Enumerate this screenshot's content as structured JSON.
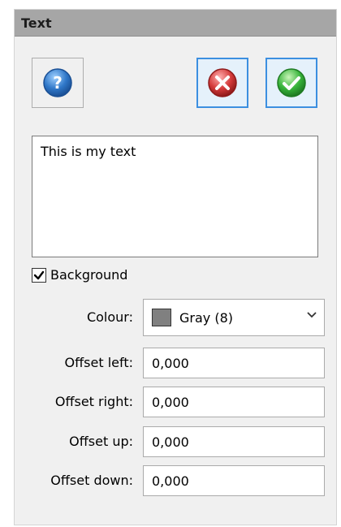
{
  "window": {
    "title": "Text"
  },
  "text_editor": {
    "value": "This is my text"
  },
  "background_checkbox": {
    "label": "Background",
    "checked": true
  },
  "colour": {
    "label": "Colour:",
    "value": "Gray (8)",
    "swatch_color": "#808080"
  },
  "offsets": [
    {
      "label": "Offset left:",
      "value": "0,000"
    },
    {
      "label": "Offset right:",
      "value": "0,000"
    },
    {
      "label": "Offset up:",
      "value": "0,000"
    },
    {
      "label": "Offset down:",
      "value": "0,000"
    }
  ],
  "icons": {
    "help": "help-icon",
    "cancel": "cancel-icon",
    "ok": "ok-icon"
  },
  "colors": {
    "help_blue": "#2f77c8",
    "cancel_red": "#d43a3a",
    "ok_green": "#37b43a",
    "focus_border": "#3c8fe0"
  }
}
